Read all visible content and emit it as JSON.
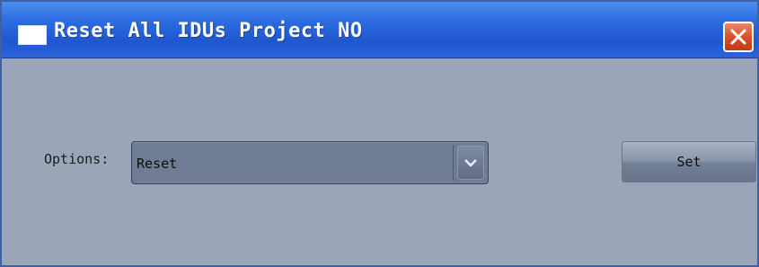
{
  "window": {
    "title": "Reset All IDUs Project NO"
  },
  "form": {
    "options_label": "Options:",
    "options_selected": "Reset",
    "set_label": "Set"
  },
  "icons": {
    "app": "window-icon",
    "close": "close-icon",
    "dropdown": "chevron-down-icon"
  },
  "colors": {
    "titlebar": "#2d6be0",
    "close_button": "#d9512a",
    "background": "#9aa5b8",
    "combo": "#6f7c93"
  }
}
